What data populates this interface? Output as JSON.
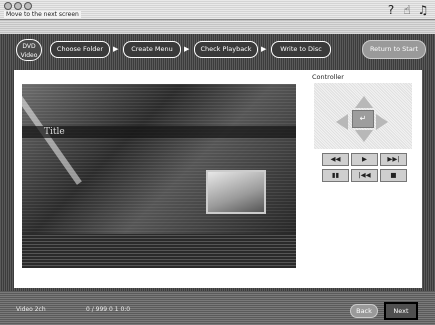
{
  "window": {
    "title": "Move to the next screen",
    "help_icon": "?",
    "hand_icon": "☝",
    "guide_icon": "♫"
  },
  "toolbar": {
    "dvd_badge_line1": "DVD",
    "dvd_badge_line2": "Video",
    "steps": [
      "Choose Folder",
      "Create Menu",
      "Check Playback",
      "Write to Disc"
    ],
    "arrow": "▶",
    "return_label": "Return to Start"
  },
  "preview": {
    "title_text": "Title"
  },
  "controller": {
    "label": "Controller",
    "enter_symbol": "↵",
    "row1": [
      "◀◀",
      "▶",
      "▶▶|"
    ],
    "row2": [
      "▮▮",
      "|◀◀",
      "■"
    ]
  },
  "status_bar": {
    "left_text": "Video 2ch",
    "middle_text": "0 / 999 0 1 0:0"
  },
  "footer": {
    "back_label": "Back",
    "next_label": "Next"
  },
  "colors": {
    "toolbar_bg": "#4a4a4a",
    "panel_bg": "#ffffff",
    "button_gray": "#9a9a9a"
  }
}
